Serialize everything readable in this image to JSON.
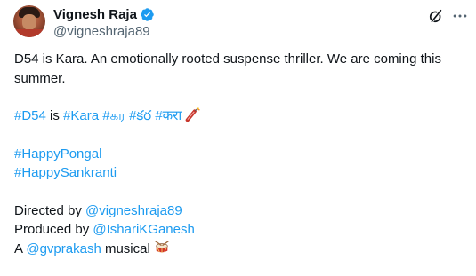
{
  "user": {
    "display_name": "Vignesh Raja",
    "handle": "@vigneshraja89",
    "avatar_icon": "profile-photo",
    "verified_icon": "verified-badge-icon",
    "verified_color": "#1d9bf0"
  },
  "actions": {
    "grok_icon": "grok-icon",
    "more_icon": "more-options-icon"
  },
  "tweet": {
    "line1": "D54 is Kara. An emotionally rooted suspense thriller. We are coming this summer.",
    "hashtags_line": {
      "tag_d54": "#D54",
      "is_word": " is ",
      "tag_kara": "#Kara",
      "tag_tamil": "#கர",
      "tag_telugu": "#కర",
      "tag_hindi": "#करा",
      "emoji": "firecracker-emoji"
    },
    "tag_happy_pongal": "#HappyPongal",
    "tag_happy_sankranti": "#HappySankranti",
    "directed_prefix": "Directed by ",
    "directed_mention": "@vigneshraja89",
    "produced_prefix": "Produced by ",
    "produced_mention": "@IshariKGanesh",
    "musical_prefix": "A ",
    "musical_mention": "@gvprakash",
    "musical_suffix": " musical ",
    "musical_emoji": "drum-emoji"
  },
  "colors": {
    "link": "#1d9bf0",
    "text": "#0f1419",
    "secondary": "#536471"
  }
}
